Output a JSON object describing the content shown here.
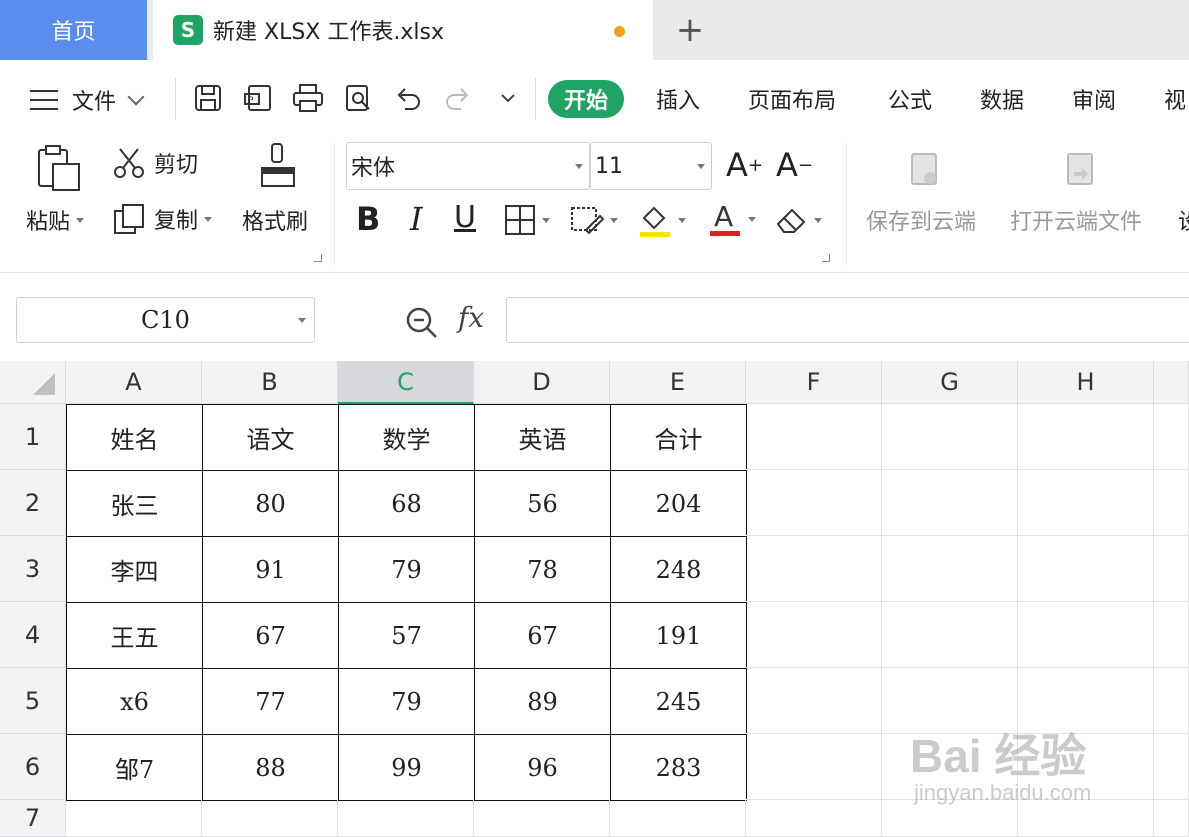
{
  "tabs": {
    "home": "首页",
    "doc_title": "新建 XLSX 工作表.xlsx",
    "add": "+"
  },
  "menu": {
    "file": "文件",
    "ribbon_tabs": [
      "开始",
      "插入",
      "页面布局",
      "公式",
      "数据",
      "审阅",
      "视"
    ]
  },
  "toolbar": {
    "paste": "粘贴",
    "cut": "剪切",
    "copy": "复制",
    "format_painter": "格式刷",
    "font_name": "宋体",
    "font_size": "11",
    "grow": "A",
    "shrink": "A",
    "bold": "B",
    "italic": "I",
    "underline": "U",
    "save_cloud": "保存到云端",
    "open_cloud": "打开云端文件",
    "extra": "设"
  },
  "formula": {
    "cell_ref": "C10",
    "fx": "fx",
    "value": ""
  },
  "grid": {
    "columns": [
      "A",
      "B",
      "C",
      "D",
      "E",
      "F",
      "G",
      "H"
    ],
    "selected_column": "C",
    "rows": [
      "1",
      "2",
      "3",
      "4",
      "5",
      "6",
      "7"
    ],
    "table": [
      [
        "姓名",
        "语文",
        "数学",
        "英语",
        "合计"
      ],
      [
        "张三",
        "80",
        "68",
        "56",
        "204"
      ],
      [
        "李四",
        "91",
        "79",
        "78",
        "248"
      ],
      [
        "王五",
        "67",
        "57",
        "67",
        "191"
      ],
      [
        "x6",
        "77",
        "79",
        "89",
        "245"
      ],
      [
        "邹7",
        "88",
        "99",
        "96",
        "283"
      ]
    ]
  },
  "watermark": {
    "main": "Bai 经验",
    "sub": "jingyan.baidu.com"
  },
  "colors": {
    "accent": "#1fa463",
    "home_tab": "#5b8def",
    "unsaved": "#f0a020",
    "highlight": "#f5e400",
    "font_color": "#e02020"
  }
}
